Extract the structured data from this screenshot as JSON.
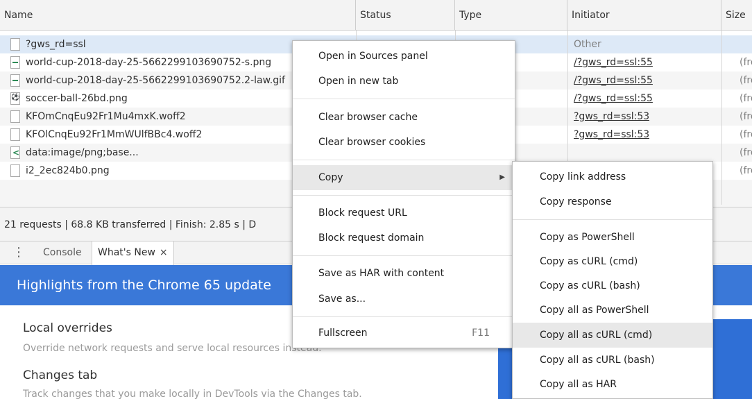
{
  "columns": {
    "name": "Name",
    "status": "Status",
    "type": "Type",
    "initiator": "Initiator",
    "size": "Size"
  },
  "rows": [
    {
      "name": "?gws_rd=ssl",
      "initiator": "Other",
      "size": ""
    },
    {
      "name": "world-cup-2018-day-25-5662299103690752-s.png",
      "initiator": "/?gws_rd=ssl:55",
      "size": "(fro"
    },
    {
      "name": "world-cup-2018-day-25-5662299103690752.2-law.gif",
      "initiator": "/?gws_rd=ssl:55",
      "size": "(fro"
    },
    {
      "name": "soccer-ball-26bd.png",
      "initiator": "/?gws_rd=ssl:55",
      "size": "(fro"
    },
    {
      "name": "KFOmCnqEu92Fr1Mu4mxK.woff2",
      "initiator": "?gws_rd=ssl:53",
      "size": "(fro"
    },
    {
      "name": "KFOlCnqEu92Fr1MmWUlfBBc4.woff2",
      "initiator": "?gws_rd=ssl:53",
      "size": "(fro"
    },
    {
      "name": "data:image/png;base...",
      "initiator": "",
      "size": "(fro"
    },
    {
      "name": "i2_2ec824b0.png",
      "initiator": "",
      "size": "(fro"
    }
  ],
  "summary": "21 requests | 68.8 KB transferred | Finish: 2.85 s | D",
  "drawer": {
    "console_tab": "Console",
    "whats_new_tab": "What's New",
    "close_glyph": "×",
    "kebab_glyph": "⋮"
  },
  "whats_new": {
    "banner": "Highlights from the Chrome 65 update",
    "features": [
      {
        "title": "Local overrides",
        "desc": "Override network requests and serve local resources instead."
      },
      {
        "title": "Changes tab",
        "desc": "Track changes that you make locally in DevTools via the Changes tab."
      }
    ]
  },
  "context_menu": {
    "open_sources": "Open in Sources panel",
    "open_tab": "Open in new tab",
    "clear_cache": "Clear browser cache",
    "clear_cookies": "Clear browser cookies",
    "copy": "Copy",
    "copy_arrow": "▶",
    "block_url": "Block request URL",
    "block_domain": "Block request domain",
    "save_har": "Save as HAR with content",
    "save_as": "Save as...",
    "fullscreen": "Fullscreen",
    "fullscreen_shortcut": "F11"
  },
  "copy_submenu": {
    "link_address": "Copy link address",
    "response": "Copy response",
    "as_powershell": "Copy as PowerShell",
    "as_curl_cmd": "Copy as cURL (cmd)",
    "as_curl_bash": "Copy as cURL (bash)",
    "all_powershell": "Copy all as PowerShell",
    "all_curl_cmd": "Copy all as cURL (cmd)",
    "all_curl_bash": "Copy all as cURL (bash)",
    "all_har": "Copy all as HAR"
  },
  "colors": {
    "banner_blue": "#3a78d8",
    "selected_row": "#dde9f7",
    "menu_highlight": "#e8e8e8"
  }
}
